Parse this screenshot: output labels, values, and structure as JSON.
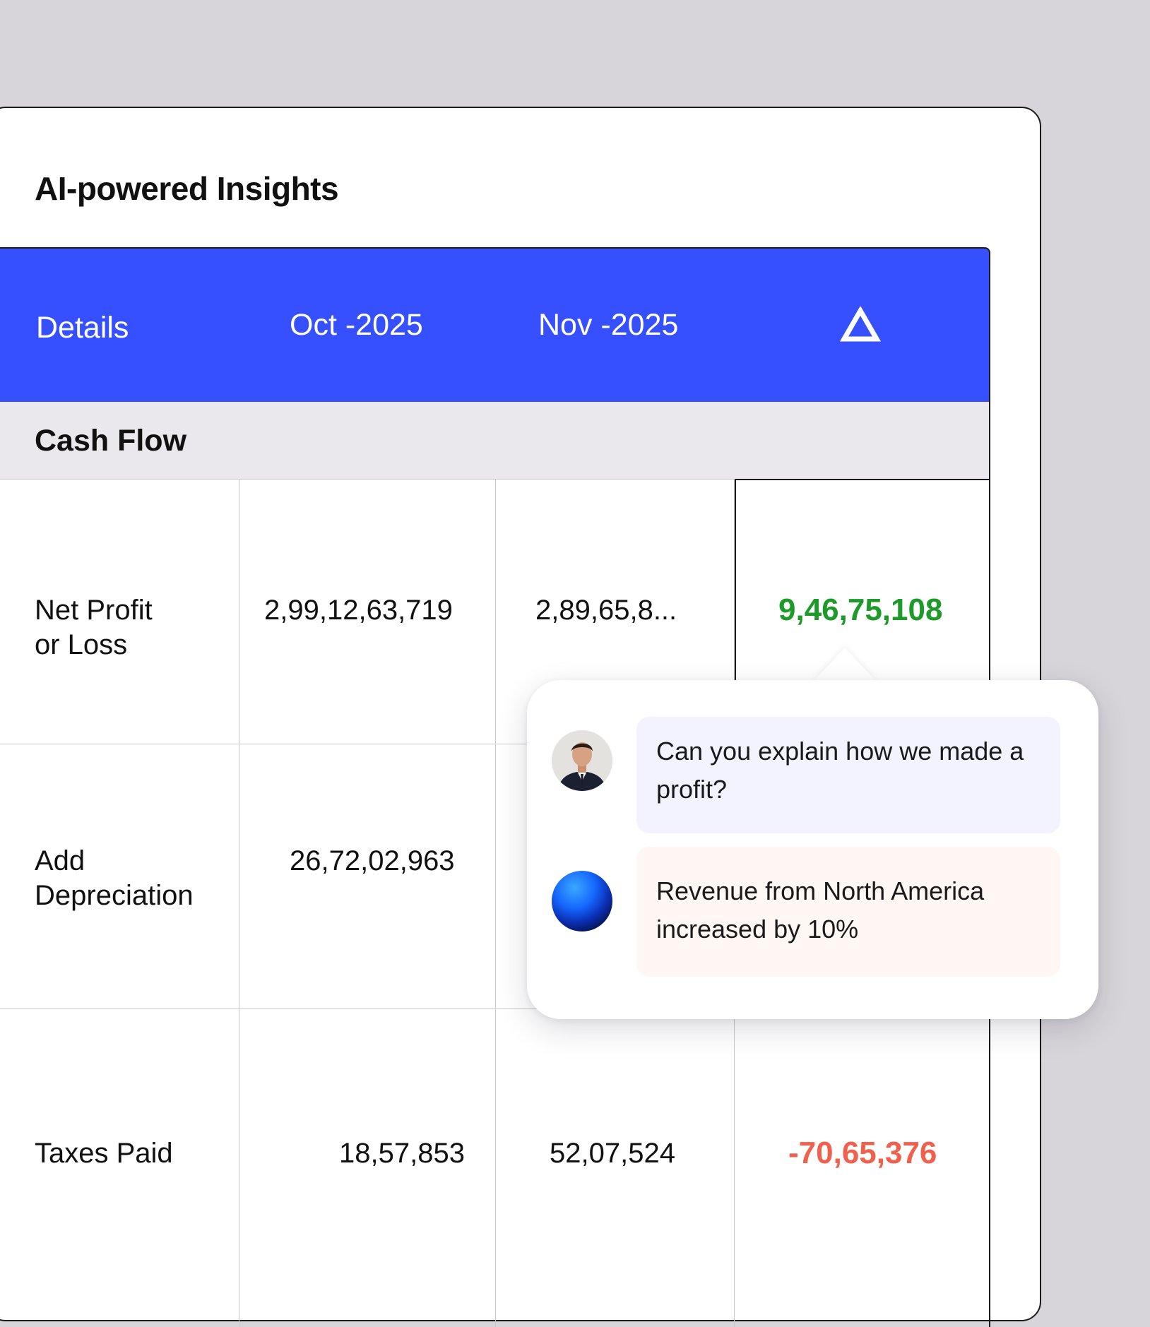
{
  "panel": {
    "title": "AI-powered Insights"
  },
  "table": {
    "headers": {
      "details": "Details",
      "oct": "Oct -2025",
      "nov": "Nov -2025",
      "delta_icon": "delta-triangle-icon"
    },
    "section": "Cash Flow",
    "rows": [
      {
        "label_line1": "Net Profit",
        "label_line2": "or Loss",
        "oct": "2,99,12,63,719",
        "nov": "2,89,65,8...",
        "delta": "9,46,75,108",
        "delta_status": "positive"
      },
      {
        "label_line1": "Add",
        "label_line2": "Depreciation",
        "oct": "26,72,02,963",
        "nov": "",
        "delta": "",
        "delta_status": ""
      },
      {
        "label_line1": "Taxes Paid",
        "label_line2": "",
        "oct": "18,57,853",
        "nov": "52,07,524",
        "delta": "-70,65,376",
        "delta_status": "negative"
      }
    ]
  },
  "chat": {
    "user_message": "Can you explain how we made a profit?",
    "ai_message": "Revenue from North America increased by 10%"
  },
  "colors": {
    "header_bg": "#3650ff",
    "positive": "#1e9a2a",
    "negative": "#f0604e",
    "section_bg": "#eae8ed",
    "user_bubble": "#f3f2ff",
    "ai_bubble": "#fff7f4"
  }
}
